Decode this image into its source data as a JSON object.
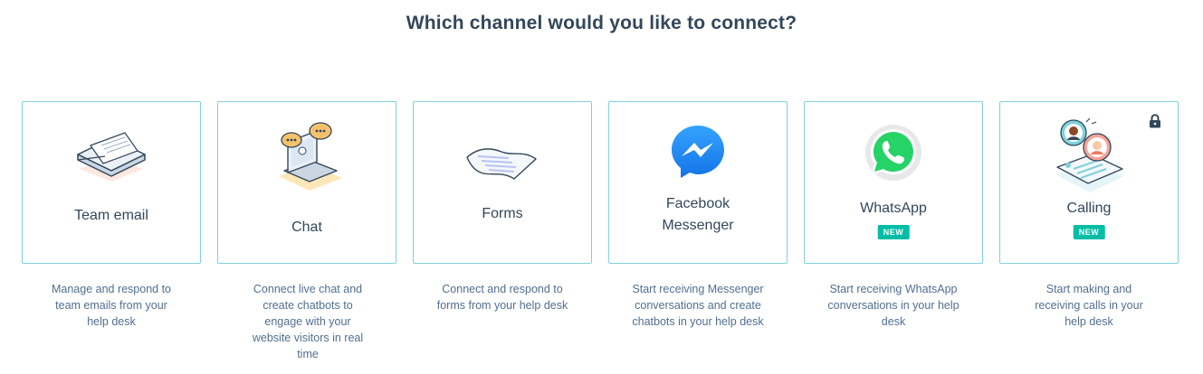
{
  "header": {
    "title": "Which channel would you like to connect?"
  },
  "channels": [
    {
      "label": "Team email",
      "icon": "envelope-icon",
      "badge": "",
      "description": "Manage and respond to team emails from your help desk"
    },
    {
      "label": "Chat",
      "icon": "laptop-chat-icon",
      "badge": "",
      "description": "Connect live chat and create chatbots to engage with your website visitors in real time"
    },
    {
      "label": "Forms",
      "icon": "form-paper-icon",
      "badge": "",
      "description": "Connect and respond to forms from your help desk"
    },
    {
      "label": "Facebook Messenger",
      "label_line1": "Facebook",
      "label_line2": "Messenger",
      "icon": "messenger-icon",
      "badge": "",
      "description": "Start receiving Messenger conversations and create chatbots in your help desk"
    },
    {
      "label": "WhatsApp",
      "icon": "whatsapp-icon",
      "badge": "NEW",
      "description": "Start receiving WhatsApp conversations in your help desk"
    },
    {
      "label": "Calling",
      "icon": "calling-icon",
      "badge": "NEW",
      "locked": true,
      "description": "Start making and receiving calls in your help desk"
    }
  ],
  "colors": {
    "card_border": "#7fd1de",
    "badge_bg": "#00bda5",
    "messenger_blue": "#1e88f5",
    "whatsapp_green": "#25d366"
  }
}
